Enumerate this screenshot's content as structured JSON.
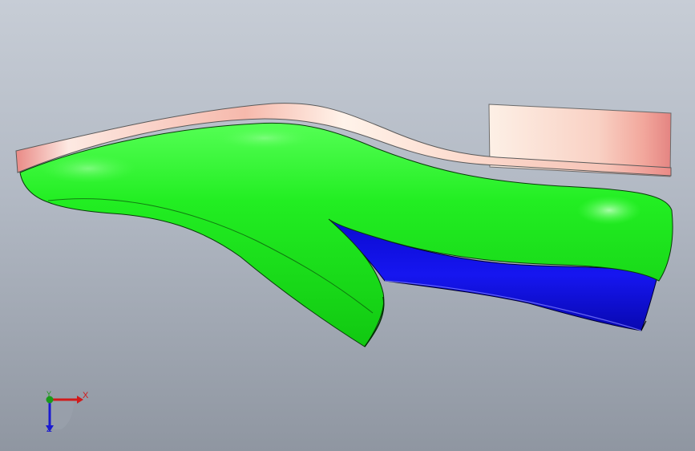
{
  "viewport": {
    "background_top": "#c7cdd6",
    "background_bottom": "#8f96a1"
  },
  "model": {
    "parts": [
      {
        "name": "insole",
        "color": "#f2b9b0"
      },
      {
        "name": "heel-block",
        "color": "#f3c2b8"
      },
      {
        "name": "upper",
        "color": "#22ee22"
      },
      {
        "name": "outsole",
        "color": "#1010e0"
      }
    ]
  },
  "triad": {
    "x_label": "X",
    "y_label": "Y",
    "z_label": "Z",
    "x_color": "#d11a1a",
    "y_color": "#1a9a1a",
    "z_color": "#1a1ad1"
  }
}
